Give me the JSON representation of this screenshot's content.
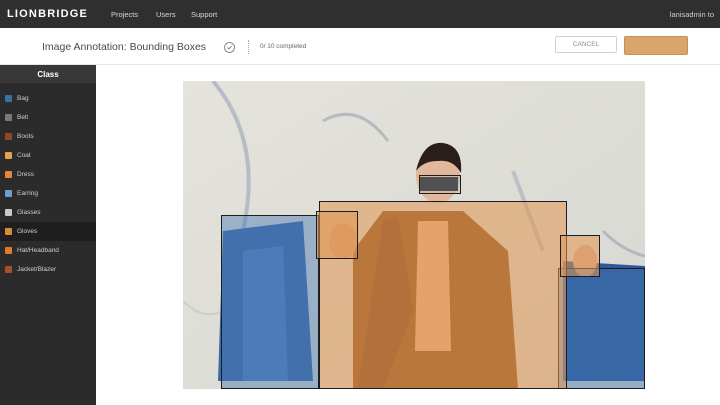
{
  "nav": {
    "logo": "LIONBRIDGE",
    "links": [
      "Projects",
      "Users",
      "Support"
    ],
    "user": "lanisadmin to"
  },
  "header": {
    "title": "Image Annotation: Bounding Boxes",
    "progress": "0/ 10 completed",
    "cancel_label": "CANCEL",
    "submit_label": ""
  },
  "sidebar": {
    "title": "Class",
    "items": [
      {
        "label": "Bag",
        "color": "#3d6ea8",
        "icon": "bag-icon"
      },
      {
        "label": "Belt",
        "color": "#7a7a7a",
        "icon": "belt-icon"
      },
      {
        "label": "Boots",
        "color": "#8b4a22",
        "icon": "boots-icon"
      },
      {
        "label": "Coat",
        "color": "#e0a050",
        "icon": "coat-icon"
      },
      {
        "label": "Dress",
        "color": "#e08a3a",
        "icon": "dress-icon"
      },
      {
        "label": "Earring",
        "color": "#6aa0d0",
        "icon": "earring-icon"
      },
      {
        "label": "Glasses",
        "color": "#c9c9c9",
        "icon": "glasses-icon"
      },
      {
        "label": "Gloves",
        "color": "#d98a3a",
        "icon": "gloves-icon"
      },
      {
        "label": "Hat/Headband",
        "color": "#e07a2a",
        "icon": "hat-icon"
      },
      {
        "label": "Jacket/Blazer",
        "color": "#a0522d",
        "icon": "jacket-icon"
      }
    ],
    "active_index": 7
  },
  "colors": {
    "topbar": "#2f2f2f",
    "sidebar": "#2b2b2b",
    "accent": "#d9a56e",
    "coat_box": "#e0a050",
    "bag_box": "#4678b4"
  }
}
